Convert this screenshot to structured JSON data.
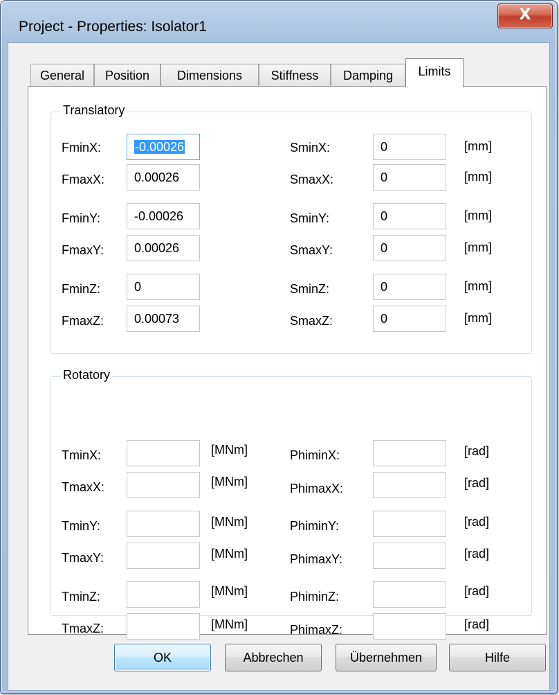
{
  "window": {
    "title": "Project - Properties: Isolator1",
    "close_glyph": "X"
  },
  "tabs": [
    {
      "label": "General"
    },
    {
      "label": "Position"
    },
    {
      "label": "Dimensions"
    },
    {
      "label": "Stiffness"
    },
    {
      "label": "Damping"
    },
    {
      "label": "Limits"
    }
  ],
  "active_tab": "Limits",
  "translatory": {
    "label": "Translatory",
    "rows": [
      {
        "f_label": "FminX:",
        "f_value": "-0.00026",
        "s_label": "SminX:",
        "s_value": "0",
        "unit": "[mm]"
      },
      {
        "f_label": "FmaxX:",
        "f_value": "0.00026",
        "s_label": "SmaxX:",
        "s_value": "0",
        "unit": "[mm]"
      },
      {
        "f_label": "FminY:",
        "f_value": "-0.00026",
        "s_label": "SminY:",
        "s_value": "0",
        "unit": "[mm]"
      },
      {
        "f_label": "FmaxY:",
        "f_value": "0.00026",
        "s_label": "SmaxY:",
        "s_value": "0",
        "unit": "[mm]"
      },
      {
        "f_label": "FminZ:",
        "f_value": "0",
        "s_label": "SminZ:",
        "s_value": "0",
        "unit": "[mm]"
      },
      {
        "f_label": "FmaxZ:",
        "f_value": "0.00073",
        "s_label": "SmaxZ:",
        "s_value": "0",
        "unit": "[mm]"
      }
    ]
  },
  "rotatory": {
    "label": "Rotatory",
    "rows": [
      {
        "t_label": "TminX:",
        "t_value": "",
        "t_unit": "[MNm]",
        "p_label": "PhiminX:",
        "p_value": "",
        "p_unit": "[rad]"
      },
      {
        "t_label": "TmaxX:",
        "t_value": "",
        "t_unit": "[MNm]",
        "p_label": "PhimaxX:",
        "p_value": "",
        "p_unit": "[rad]"
      },
      {
        "t_label": "TminY:",
        "t_value": "",
        "t_unit": "[MNm]",
        "p_label": "PhiminY:",
        "p_value": "",
        "p_unit": "[rad]"
      },
      {
        "t_label": "TmaxY:",
        "t_value": "",
        "t_unit": "[MNm]",
        "p_label": "PhimaxY:",
        "p_value": "",
        "p_unit": "[rad]"
      },
      {
        "t_label": "TminZ:",
        "t_value": "",
        "t_unit": "[MNm]",
        "p_label": "PhiminZ:",
        "p_value": "",
        "p_unit": "[rad]"
      },
      {
        "t_label": "TmaxZ:",
        "t_value": "",
        "t_unit": "[MNm]",
        "p_label": "PhimaxZ:",
        "p_value": "",
        "p_unit": "[rad]"
      }
    ]
  },
  "buttons": {
    "ok": "OK",
    "cancel": "Abbrechen",
    "apply": "Übernehmen",
    "help": "Hilfe"
  }
}
